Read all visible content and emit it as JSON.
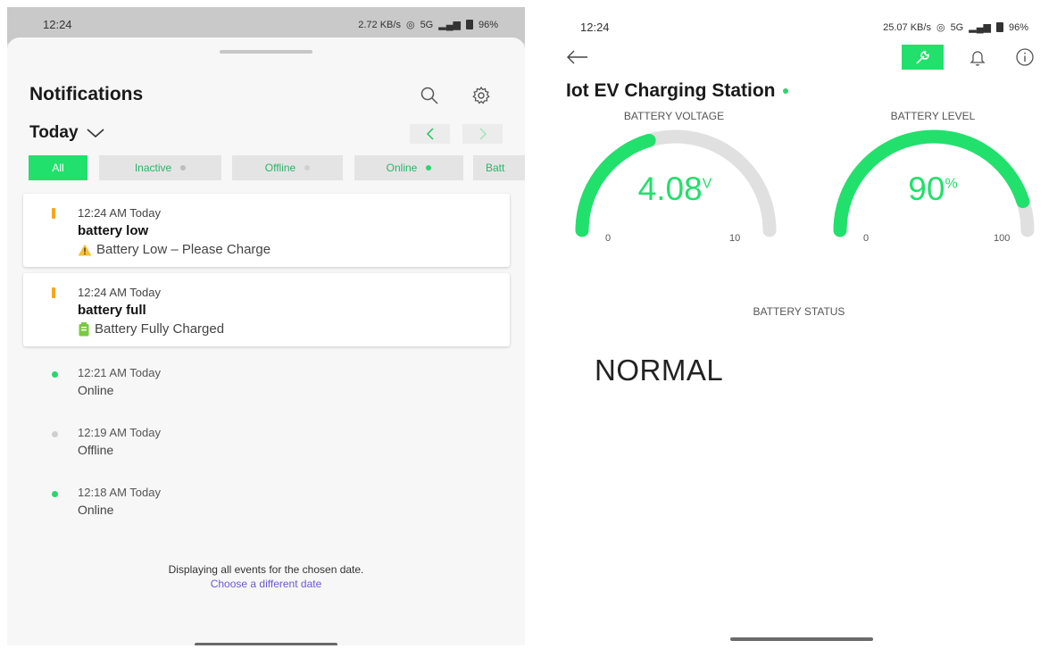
{
  "left": {
    "status_bar": {
      "time": "12:24",
      "net_badge": "⁽ᶻᶻ⁾",
      "speed": "2.72 KB/s",
      "network": "5G",
      "battery": "96%"
    },
    "title": "Notifications",
    "date_filter": "Today",
    "chips": [
      {
        "label": "All",
        "dot_color": ""
      },
      {
        "label": "Inactive",
        "dot_color": "#bdbdbd"
      },
      {
        "label": "Offline",
        "dot_color": "#d0d0d0"
      },
      {
        "label": "Online",
        "dot_color": "#2bd66b"
      },
      {
        "label": "Batt",
        "dot_color": ""
      }
    ],
    "cards": [
      {
        "time": "12:24 AM Today",
        "title": "battery low",
        "message": "Battery Low – Please Charge",
        "icon": "warning-icon"
      },
      {
        "time": "12:24 AM Today",
        "title": "battery full",
        "message": "Battery Fully Charged",
        "icon": "battery-icon"
      }
    ],
    "events": [
      {
        "time": "12:21 AM Today",
        "label": "Online",
        "dot_color": "#2bd66b"
      },
      {
        "time": "12:19 AM Today",
        "label": "Offline",
        "dot_color": "#cfcfcf"
      },
      {
        "time": "12:18 AM Today",
        "label": "Online",
        "dot_color": "#2bd66b"
      }
    ],
    "footer_text": "Displaying all events for the chosen date.",
    "footer_link": "Choose a different date"
  },
  "right": {
    "status_bar": {
      "time": "12:24",
      "net_badge": "⁽ᶻᶻ⁾",
      "speed": "25.07 KB/s",
      "network": "5G",
      "battery": "96%"
    },
    "device_title": "Iot EV Charging Station",
    "gauges": [
      {
        "label": "BATTERY VOLTAGE",
        "value": "4.08",
        "unit": "V",
        "min": "0",
        "max": "10",
        "fraction": 0.408
      },
      {
        "label": "BATTERY LEVEL",
        "value": "90",
        "unit": "%",
        "min": "0",
        "max": "100",
        "fraction": 0.9
      }
    ],
    "status_label": "BATTERY STATUS",
    "status_value": "NORMAL"
  },
  "colors": {
    "accent": "#22e06c",
    "track": "#e0e0e0",
    "warning": "#f5a623",
    "link": "#6a5acd"
  }
}
